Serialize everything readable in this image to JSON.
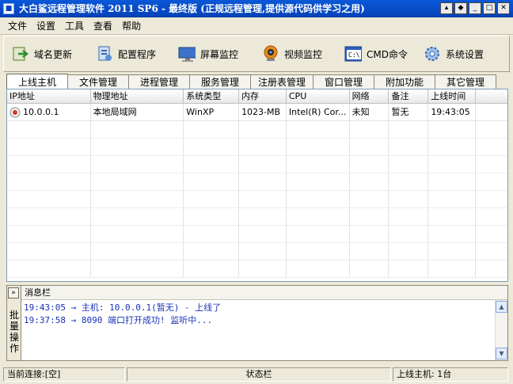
{
  "window": {
    "title": "大白鲨远程管理软件 2011 SP6 - 最终版 (正规远程管理,提供源代码供学习之用)"
  },
  "menu": [
    "文件",
    "设置",
    "工具",
    "查看",
    "帮助"
  ],
  "toolbar": [
    {
      "label": "域名更新",
      "icon": "domain-update-icon"
    },
    {
      "label": "配置程序",
      "icon": "config-icon"
    },
    {
      "label": "屏幕监控",
      "icon": "monitor-icon"
    },
    {
      "label": "视频监控",
      "icon": "webcam-icon"
    },
    {
      "label": "CMD命令",
      "icon": "cmd-icon"
    },
    {
      "label": "系统设置",
      "icon": "gear-icon"
    }
  ],
  "tabs": [
    "上线主机",
    "文件管理",
    "进程管理",
    "服务管理",
    "注册表管理",
    "窗口管理",
    "附加功能",
    "其它管理"
  ],
  "table": {
    "columns": [
      "IP地址",
      "物理地址",
      "系统类型",
      "内存",
      "CPU",
      "网络",
      "备注",
      "上线时间"
    ],
    "rows": [
      [
        "10.0.0.1",
        "本地局域网",
        "WinXP",
        "1023-MB",
        "Intel(R) Cor...",
        "未知",
        "暂无",
        "19:43:05"
      ]
    ]
  },
  "messages": {
    "header": "消息栏",
    "side_label": "批量操作",
    "lines": [
      "19:43:05 → 主机: 10.0.0.1(暂无) - 上线了",
      "19:37:58 → 8090 端口打开成功! 监听中..."
    ]
  },
  "status": {
    "current": "当前连接:[空]",
    "bar": "状态栏",
    "online": "上线主机: 1台"
  },
  "colors": {
    "title_bar": "#0a58d8",
    "log_text": "#1a33b8",
    "panel_bg": "#ece9d8"
  }
}
